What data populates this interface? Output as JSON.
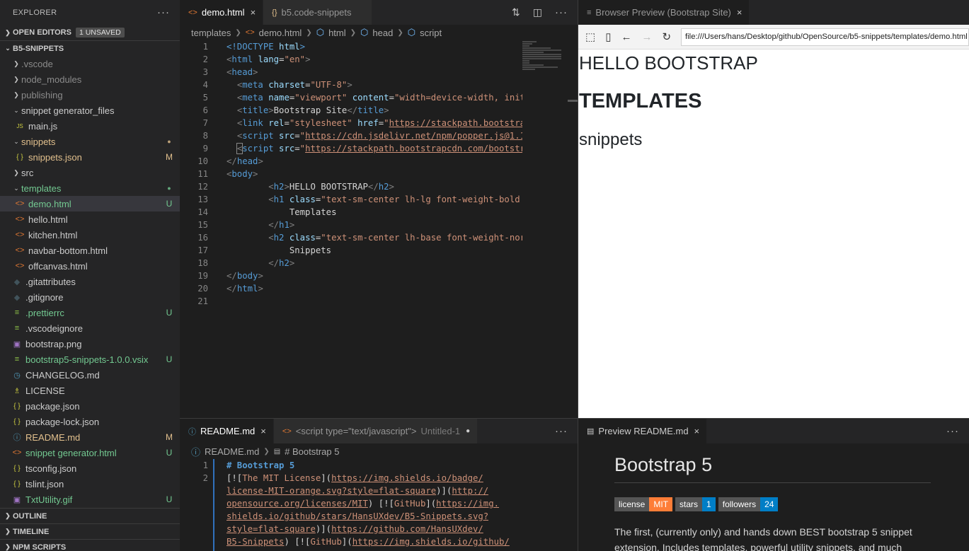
{
  "sidebar": {
    "title": "EXPLORER",
    "more": "···",
    "open_editors": {
      "label": "OPEN EDITORS",
      "badge": "1 UNSAVED"
    },
    "project": "B5-SNIPPETS",
    "items": [
      {
        "label": ".vscode",
        "type": "folder",
        "indent": 1,
        "color": "dim",
        "deco": ""
      },
      {
        "label": "node_modules",
        "type": "folder",
        "indent": 1,
        "color": "dim",
        "deco": ""
      },
      {
        "label": "publishing",
        "type": "folder",
        "indent": 1,
        "color": "dim",
        "deco": ""
      },
      {
        "label": "snippet generator_files",
        "type": "folder-open",
        "indent": 1,
        "color": "",
        "deco": ""
      },
      {
        "label": "main.js",
        "type": "js",
        "indent": 2,
        "color": "",
        "deco": ""
      },
      {
        "label": "snippets",
        "type": "folder-open",
        "indent": 1,
        "color": "yellow",
        "deco": "●"
      },
      {
        "label": "snippets.json",
        "type": "json",
        "indent": 2,
        "color": "yellow",
        "deco": "M"
      },
      {
        "label": "src",
        "type": "folder",
        "indent": 1,
        "color": "",
        "deco": ""
      },
      {
        "label": "templates",
        "type": "folder-open",
        "indent": 1,
        "color": "green",
        "deco": "●"
      },
      {
        "label": "demo.html",
        "type": "html",
        "indent": 2,
        "color": "green",
        "deco": "U",
        "active": true
      },
      {
        "label": "hello.html",
        "type": "html",
        "indent": 2,
        "color": "",
        "deco": ""
      },
      {
        "label": "kitchen.html",
        "type": "html",
        "indent": 2,
        "color": "",
        "deco": ""
      },
      {
        "label": "navbar-bottom.html",
        "type": "html",
        "indent": 2,
        "color": "",
        "deco": ""
      },
      {
        "label": "offcanvas.html",
        "type": "html",
        "indent": 2,
        "color": "",
        "deco": ""
      },
      {
        "label": ".gitattributes",
        "type": "git",
        "indent": 1,
        "color": "",
        "deco": ""
      },
      {
        "label": ".gitignore",
        "type": "git",
        "indent": 1,
        "color": "",
        "deco": ""
      },
      {
        "label": ".prettierrc",
        "type": "config",
        "indent": 1,
        "color": "green",
        "deco": "U"
      },
      {
        "label": ".vscodeignore",
        "type": "config",
        "indent": 1,
        "color": "",
        "deco": ""
      },
      {
        "label": "bootstrap.png",
        "type": "image",
        "indent": 1,
        "color": "",
        "deco": ""
      },
      {
        "label": "bootstrap5-snippets-1.0.0.vsix",
        "type": "vsix",
        "indent": 1,
        "color": "green",
        "deco": "U"
      },
      {
        "label": "CHANGELOG.md",
        "type": "md",
        "indent": 1,
        "color": "",
        "deco": ""
      },
      {
        "label": "LICENSE",
        "type": "license",
        "indent": 1,
        "color": "",
        "deco": ""
      },
      {
        "label": "package.json",
        "type": "json",
        "indent": 1,
        "color": "",
        "deco": ""
      },
      {
        "label": "package-lock.json",
        "type": "json",
        "indent": 1,
        "color": "",
        "deco": ""
      },
      {
        "label": "README.md",
        "type": "info",
        "indent": 1,
        "color": "yellow",
        "deco": "M"
      },
      {
        "label": "snippet generator.html",
        "type": "html",
        "indent": 1,
        "color": "green",
        "deco": "U"
      },
      {
        "label": "tsconfig.json",
        "type": "json",
        "indent": 1,
        "color": "",
        "deco": ""
      },
      {
        "label": "tslint.json",
        "type": "json",
        "indent": 1,
        "color": "",
        "deco": ""
      },
      {
        "label": "TxtUtility.gif",
        "type": "image",
        "indent": 1,
        "color": "green",
        "deco": "U"
      }
    ],
    "bottom_sections": [
      "OUTLINE",
      "TIMELINE",
      "NPM SCRIPTS"
    ]
  },
  "editor": {
    "tabs": [
      {
        "label": "demo.html",
        "icon": "<>",
        "active": true,
        "close": "×"
      },
      {
        "label": "b5.code-snippets",
        "icon": "{}",
        "active": false,
        "close": ""
      }
    ],
    "breadcrumb": [
      "templates",
      "demo.html",
      "html",
      "head",
      "script"
    ],
    "line_numbers": [
      "1",
      "2",
      "3",
      "4",
      "5",
      "6",
      "7",
      "8",
      "9",
      "10",
      "11",
      "12",
      "13",
      "14",
      "15",
      "16",
      "17",
      "18",
      "19",
      "20",
      "21"
    ]
  },
  "browser": {
    "tab_label": "Browser Preview (Bootstrap Site)",
    "url": "file:///Users/hans/Desktop/github/OpenSource/b5-snippets/templates/demo.html",
    "h2": "HELLO BOOTSTRAP",
    "h1": "Templates",
    "h3": "Snippets"
  },
  "readme_editor": {
    "tabs": [
      {
        "label": "README.md",
        "icon": "ⓘ",
        "active": true
      },
      {
        "label": "<script type=\"text/javascript\">",
        "suffix": "Untitled-1",
        "active": false
      }
    ],
    "breadcrumb": [
      "README.md",
      "# Bootstrap 5"
    ],
    "line_numbers": [
      "1",
      "2"
    ]
  },
  "preview": {
    "tab_label": "Preview README.md",
    "title": "Bootstrap 5",
    "shields": [
      {
        "label": "license",
        "value": "MIT",
        "color": "#fe7d37"
      },
      {
        "label": "stars",
        "value": "1",
        "color": "#007ec6"
      },
      {
        "label": "followers",
        "value": "24",
        "color": "#007ec6"
      }
    ],
    "paragraph": "The first, (currently only) and hands down BEST bootstrap 5 snippet extension. Includes templates, powerful utility snippets, and much"
  }
}
